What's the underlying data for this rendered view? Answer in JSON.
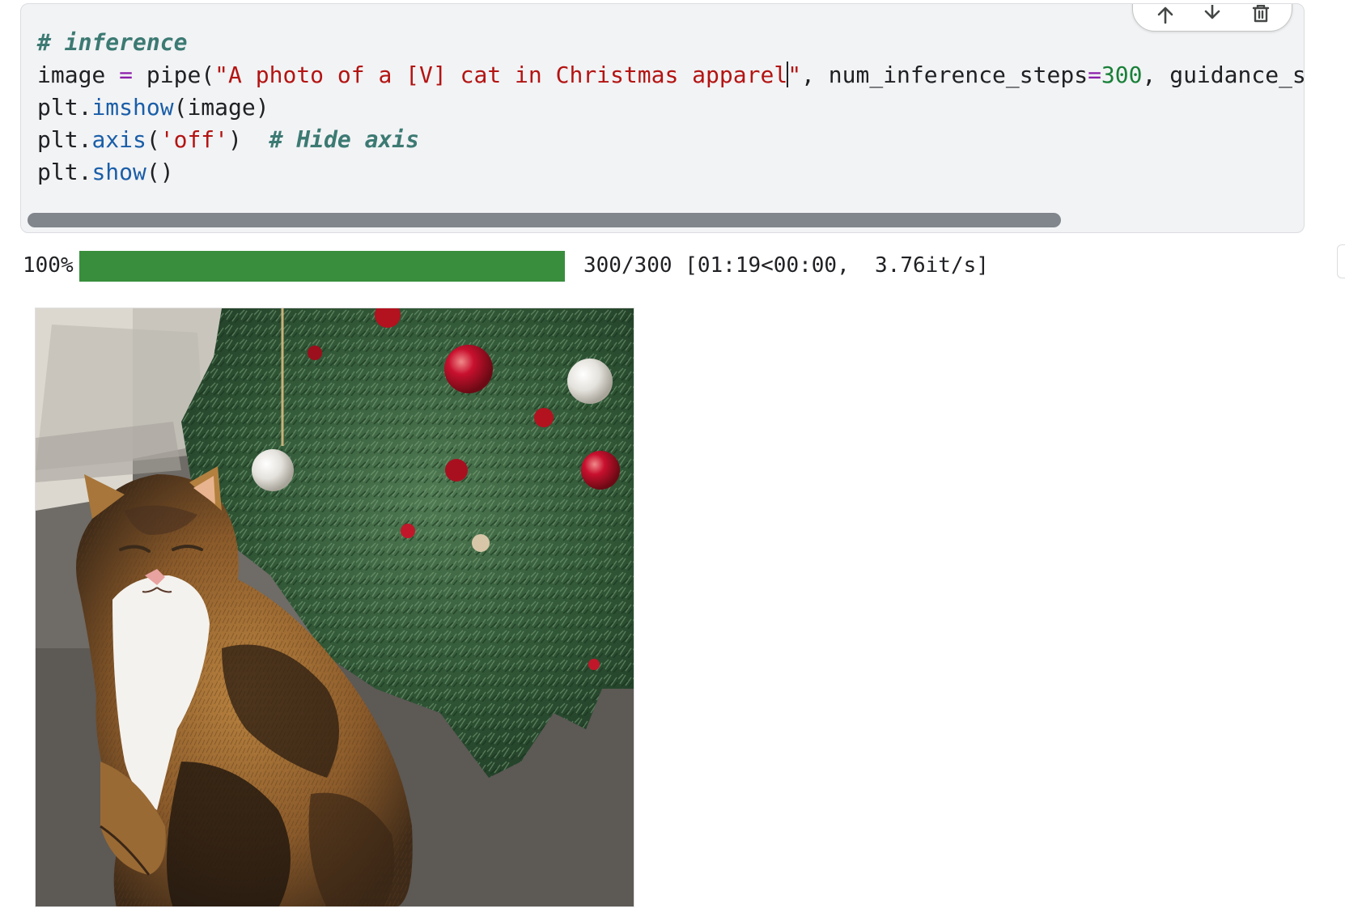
{
  "code_cell": {
    "lines": [
      {
        "segments": [
          {
            "cls": "tok-comment",
            "text": "# inference"
          }
        ]
      },
      {
        "segments": [
          {
            "cls": "",
            "text": "image "
          },
          {
            "cls": "tok-op",
            "text": "="
          },
          {
            "cls": "",
            "text": " pipe("
          },
          {
            "cls": "tok-string",
            "text": "\"A photo of a [V] cat in Christmas apparel"
          },
          {
            "cls": "cursor",
            "text": ""
          },
          {
            "cls": "tok-string",
            "text": "\""
          },
          {
            "cls": "",
            "text": ", num_inference_steps"
          },
          {
            "cls": "tok-op",
            "text": "="
          },
          {
            "cls": "tok-number",
            "text": "300"
          },
          {
            "cls": "",
            "text": ", guidance_s"
          }
        ]
      },
      {
        "segments": [
          {
            "cls": "",
            "text": "plt."
          },
          {
            "cls": "tok-func",
            "text": "imshow"
          },
          {
            "cls": "",
            "text": "(image)"
          }
        ]
      },
      {
        "segments": [
          {
            "cls": "",
            "text": "plt."
          },
          {
            "cls": "tok-func",
            "text": "axis"
          },
          {
            "cls": "",
            "text": "("
          },
          {
            "cls": "tok-string",
            "text": "'off'"
          },
          {
            "cls": "",
            "text": ")  "
          },
          {
            "cls": "tok-comment",
            "text": "# Hide axis"
          }
        ]
      },
      {
        "segments": [
          {
            "cls": "",
            "text": "plt."
          },
          {
            "cls": "tok-func",
            "text": "show"
          },
          {
            "cls": "",
            "text": "()"
          }
        ]
      }
    ],
    "horizontal_scroll_fraction": 0.81
  },
  "cell_toolbar": {
    "buttons": [
      {
        "name": "move-cell-up-button",
        "icon": "arrow-up-icon"
      },
      {
        "name": "move-cell-down-button",
        "icon": "arrow-down-icon"
      },
      {
        "name": "delete-cell-button",
        "icon": "trash-icon"
      }
    ]
  },
  "output": {
    "percent_label": "100%",
    "progress_fraction": 1.0,
    "progress_text": "300/300 [01:19<00:00,  3.76it/s]",
    "progress_color": "#388e3c"
  },
  "output_image": {
    "icon": "generated-image",
    "subject": "cat"
  },
  "colors": {
    "comment": "#3c7a73",
    "string": "#b31412",
    "operator": "#8b1fa9",
    "number": "#188038",
    "function": "#1a5ea8",
    "cell_bg": "#f2f3f5"
  }
}
